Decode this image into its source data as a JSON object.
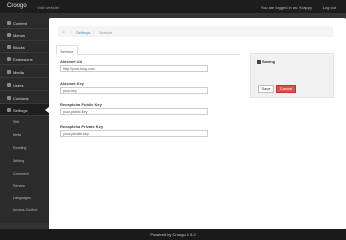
{
  "topbar": {
    "brand": "Croogo",
    "visit": "Visit website",
    "logged_in": "You are logged in as: Krappy",
    "logout": "Log out"
  },
  "sidebar": {
    "items": [
      {
        "label": "Content",
        "icon": "file-icon"
      },
      {
        "label": "Menus",
        "icon": "menu-icon"
      },
      {
        "label": "Blocks",
        "icon": "blocks-icon"
      },
      {
        "label": "Extensions",
        "icon": "puzzle-icon"
      },
      {
        "label": "Media",
        "icon": "media-icon"
      },
      {
        "label": "Users",
        "icon": "users-icon"
      },
      {
        "label": "Contacts",
        "icon": "contacts-icon"
      },
      {
        "label": "Settings",
        "icon": "gear-icon"
      }
    ],
    "subitems": [
      "Site",
      "Meta",
      "Reading",
      "Writing",
      "Comment",
      "Service",
      "Languages",
      "Access Control"
    ]
  },
  "breadcrumb": {
    "home_icon": "home-icon",
    "settings": "Settings",
    "current": "Service",
    "separator": "/"
  },
  "tab": {
    "label": "Service"
  },
  "form": {
    "akismet_url": {
      "label": "Akismet Url",
      "value": "http://your-blog.com"
    },
    "akismet_key": {
      "label": "Akismet Key",
      "value": "your-key"
    },
    "recaptcha_public": {
      "label": "Recaptcha Public Key",
      "value": "your-public-key"
    },
    "recaptcha_private": {
      "label": "Recaptcha Private Key",
      "value": "your-private-key"
    }
  },
  "panel": {
    "title": "Saving",
    "save": "Save",
    "cancel": "Cancel"
  },
  "footer": {
    "text": "Powered by Croogo 1.5.2"
  },
  "colors": {
    "cancel": "#d9534f",
    "link": "#4a90c2"
  }
}
